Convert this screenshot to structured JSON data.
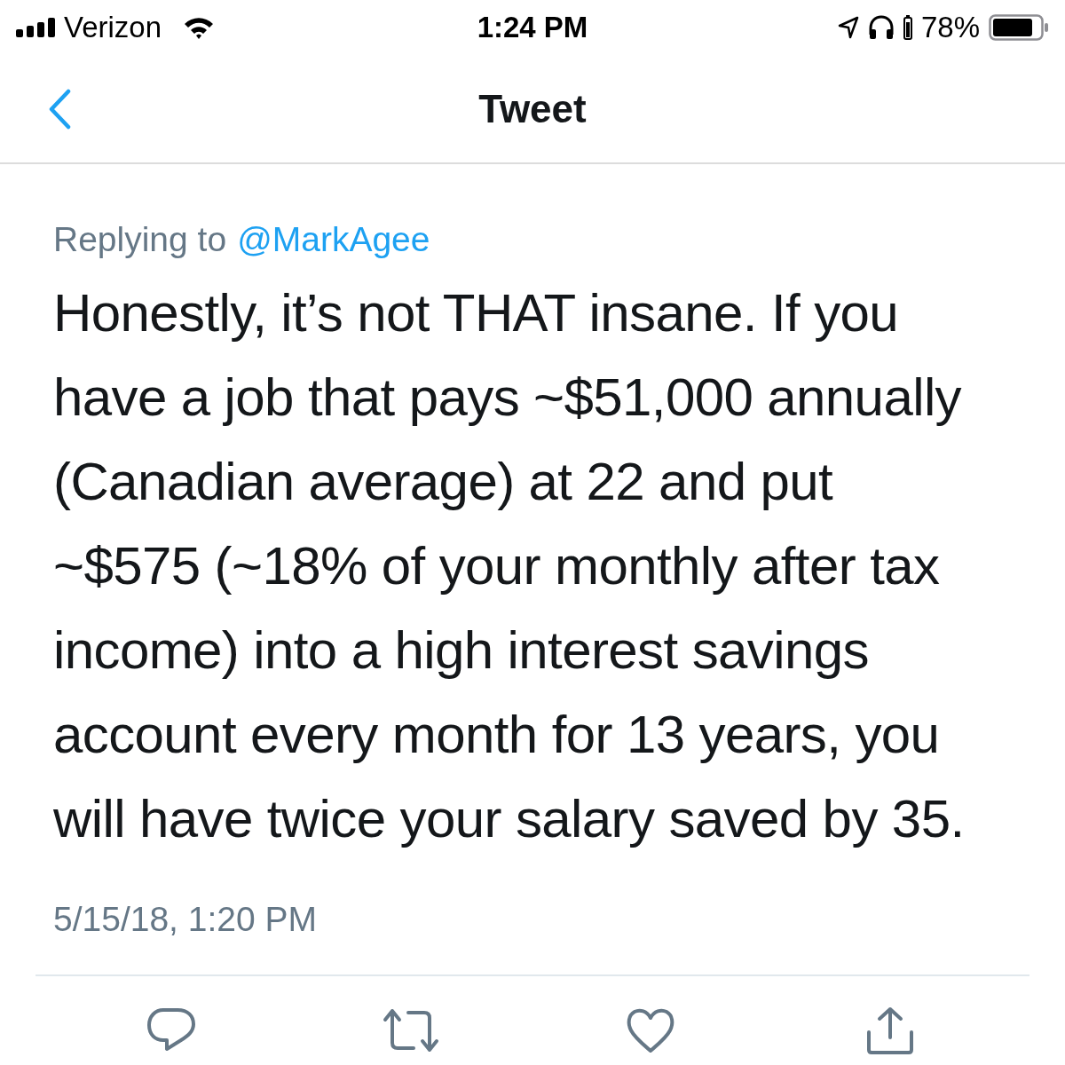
{
  "status_bar": {
    "carrier": "Verizon",
    "time": "1:24 PM",
    "battery": "78%"
  },
  "nav": {
    "title": "Tweet"
  },
  "tweet": {
    "replying_prefix": "Replying to",
    "replying_handle": "@MarkAgee",
    "text": "Honestly, it’s not THAT insane. If you have a job that pays ~$51,000 annually (Canadian average) at 22 and put ~$575 (~18% of your monthly after tax income) into a high interest savings account every month for 13 years, you will have twice your salary saved by 35.",
    "timestamp": "5/15/18, 1:20 PM"
  },
  "actions": [
    {
      "kind": "reply"
    },
    {
      "kind": "retweet"
    },
    {
      "kind": "like"
    },
    {
      "kind": "share"
    }
  ]
}
